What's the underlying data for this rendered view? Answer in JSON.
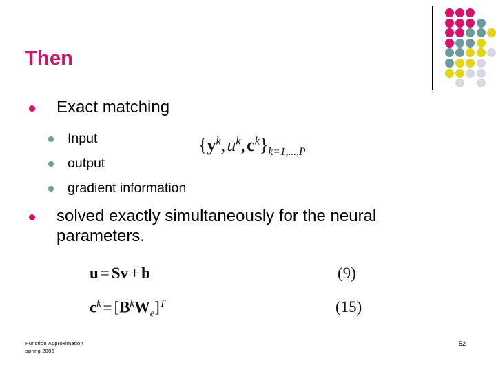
{
  "slide": {
    "title": "Then",
    "title_color": "#C9176A",
    "background": "#ffffff",
    "page_number": "52"
  },
  "decoration": {
    "name": "dot-grid-decoration",
    "rule_color": "#000000",
    "colors": {
      "magenta": "#D6136B",
      "teal": "#6E9A9C",
      "yellow": "#E3D617",
      "lightgray": "#D6D8E4"
    },
    "grid": [
      [
        "magenta",
        "magenta",
        "magenta",
        null,
        null
      ],
      [
        "magenta",
        "magenta",
        "magenta",
        "teal",
        null
      ],
      [
        "magenta",
        "magenta",
        "teal",
        "teal",
        "yellow"
      ],
      [
        "magenta",
        "teal",
        "teal",
        "yellow",
        null
      ],
      [
        "teal",
        "teal",
        "yellow",
        "yellow",
        "lightgray"
      ],
      [
        "teal",
        "yellow",
        "yellow",
        "lightgray",
        null
      ],
      [
        "yellow",
        "yellow",
        "lightgray",
        "lightgray",
        null
      ],
      [
        null,
        "lightgray",
        null,
        "lightgray",
        null
      ]
    ]
  },
  "content": {
    "bullet1": {
      "text": "Exact matching",
      "marker_color": "#D6136B"
    },
    "sub_bullets": [
      {
        "text": "Input",
        "marker_color": "#6E9A9C"
      },
      {
        "text": "output",
        "marker_color": "#6E9A9C"
      },
      {
        "text": "gradient information",
        "marker_color": "#6E9A9C"
      }
    ],
    "bullet2": {
      "text": "solved exactly simultaneously for the neural parameters.",
      "marker_color": "#D6136B"
    }
  },
  "math": {
    "dataset_set": {
      "plain": "{y^k, u^k, c^k}_{k=1,...,P}",
      "open_brace": "{",
      "var_y": "y",
      "sup_k": "k",
      "comma": ",",
      "var_u": "u",
      "var_c": "c",
      "close_brace": "}",
      "subscript_range": "k=1,...,P"
    },
    "equation9": {
      "plain": "u = Sv + b",
      "lhs": "u",
      "equals": "=",
      "mat_s": "S",
      "vec_v": "v",
      "plus": "+",
      "vec_b": "b",
      "number": "(9)"
    },
    "equation15": {
      "plain": "c^k = [B^k W_e]^T",
      "lhs_c": "c",
      "lhs_sup": "k",
      "equals": "=",
      "bracket_open": "[",
      "mat_b": "B",
      "mat_b_sup": "k",
      "mat_w": "W",
      "mat_w_sub": "e",
      "bracket_close": "]",
      "transpose": "T",
      "number": "(15)"
    }
  },
  "footer": {
    "line1": "Function Approximation",
    "line2": "spring 2006",
    "page": "52"
  }
}
